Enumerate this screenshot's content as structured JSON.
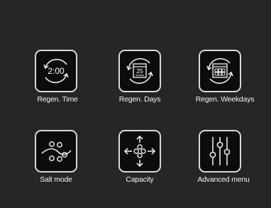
{
  "menu": {
    "items": [
      {
        "label": "Regen. Time",
        "icon": "clock-cycle-icon",
        "value": "2:00"
      },
      {
        "label": "Regen. Days",
        "icon": "calendar-cycle-icon",
        "value": "25"
      },
      {
        "label": "Regen. Weekdays",
        "icon": "weekday-calendar-cycle-icon"
      },
      {
        "label": "Salt mode",
        "icon": "salt-wave-icon"
      },
      {
        "label": "Capacity",
        "icon": "capacity-arrows-icon"
      },
      {
        "label": "Advanced menu",
        "icon": "sliders-icon"
      }
    ]
  },
  "colors": {
    "background": "#262626",
    "button_fill": "#0c0c0c",
    "button_border": "#d9d9d9",
    "text": "#f2f2f2"
  }
}
